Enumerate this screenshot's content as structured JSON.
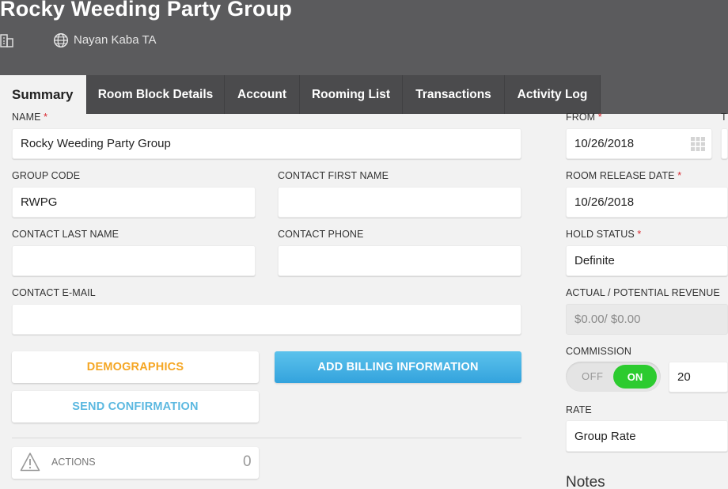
{
  "header": {
    "title": "Rocky Weeding Party Group",
    "travel_agent": "Nayan Kaba TA"
  },
  "tabs": [
    {
      "label": "Summary",
      "active": true
    },
    {
      "label": "Room Block Details",
      "active": false
    },
    {
      "label": "Account",
      "active": false
    },
    {
      "label": "Rooming List",
      "active": false
    },
    {
      "label": "Transactions",
      "active": false
    },
    {
      "label": "Activity Log",
      "active": false
    }
  ],
  "form": {
    "name": {
      "label": "NAME",
      "required": "*",
      "value": "Rocky Weeding Party Group"
    },
    "group_code": {
      "label": "GROUP CODE",
      "value": "RWPG"
    },
    "contact_first_name": {
      "label": "CONTACT FIRST NAME",
      "value": ""
    },
    "contact_last_name": {
      "label": "CONTACT LAST NAME",
      "value": ""
    },
    "contact_phone": {
      "label": "CONTACT PHONE",
      "value": ""
    },
    "contact_email": {
      "label": "CONTACT E-MAIL",
      "value": ""
    }
  },
  "buttons": {
    "demographics": "DEMOGRAPHICS",
    "add_billing": "ADD BILLING INFORMATION",
    "send_confirmation": "SEND CONFIRMATION"
  },
  "actions": {
    "label": "ACTIONS",
    "count": "0"
  },
  "right": {
    "from": {
      "label": "FROM",
      "required": "*",
      "value": "10/26/2018"
    },
    "to_label_partial": "T",
    "room_release_date": {
      "label": "ROOM RELEASE DATE",
      "required": "*",
      "value": "10/26/2018"
    },
    "hold_status": {
      "label": "HOLD STATUS",
      "required": "*",
      "value": "Definite"
    },
    "revenue": {
      "label": "ACTUAL / POTENTIAL REVENUE",
      "value": "$0.00/ $0.00"
    },
    "commission": {
      "label": "COMMISSION",
      "off": "OFF",
      "on": "ON",
      "value": "20"
    },
    "rate": {
      "label": "RATE",
      "value": "Group Rate"
    },
    "notes_heading": "Notes"
  },
  "colors": {
    "header_bg": "#5b5b5d",
    "demographics": "#f5a623",
    "send_confirmation": "#5bb8e0",
    "billing_button": "#3aa8e0",
    "toggle_on": "#2ccb2f",
    "required": "#d9282f"
  }
}
